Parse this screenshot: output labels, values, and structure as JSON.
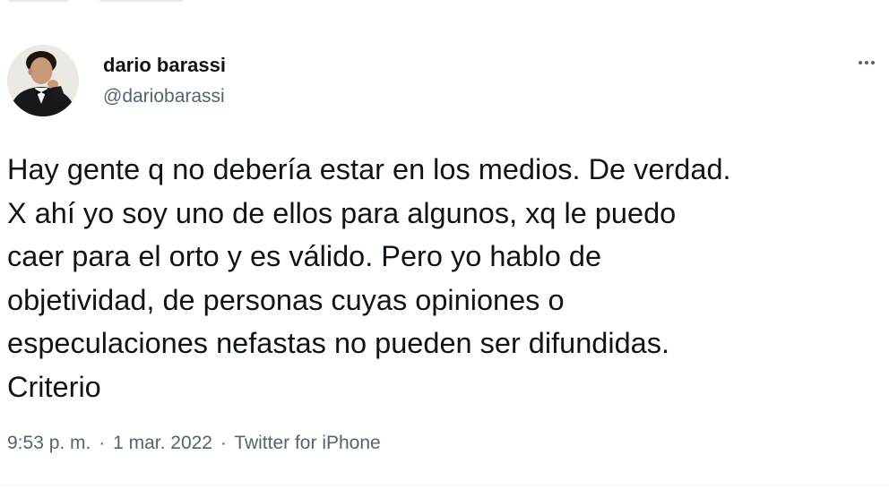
{
  "author": {
    "display_name": "dario barassi",
    "handle": "@dariobarassi"
  },
  "tweet": {
    "text": "Hay gente q no debería estar en los medios. De verdad.\nX ahí yo soy uno de ellos para algunos, xq le puedo\ncaer para el orto y es válido. Pero yo hablo de\nobjetividad, de personas cuyas opiniones o\nespeculaciones nefastas no pueden ser difundidas.\nCriterio",
    "time": "9:53 p. m.",
    "separator": "·",
    "date": "1 mar. 2022",
    "source": "Twitter for iPhone"
  },
  "icons": {
    "more": "more-horizontal-icon"
  },
  "colors": {
    "text_primary": "#0f1419",
    "text_secondary": "#536471",
    "divider": "#eff3f4",
    "background": "#ffffff"
  }
}
